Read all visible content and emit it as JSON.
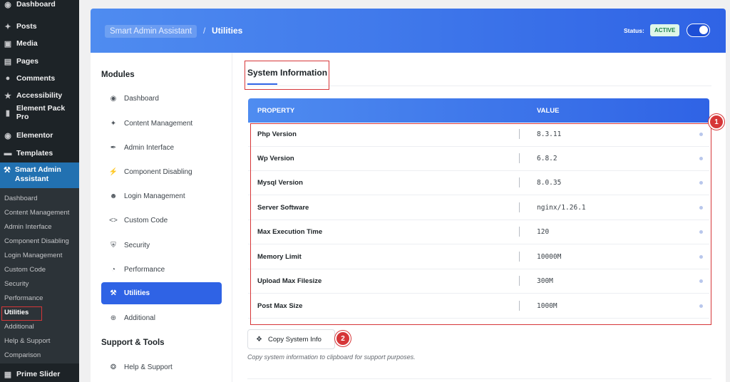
{
  "wp_menu": [
    {
      "label": "Dashboard",
      "icon": "dashboard-icon"
    },
    {
      "label": "Posts",
      "icon": "pin-icon"
    },
    {
      "label": "Media",
      "icon": "media-icon"
    },
    {
      "label": "Pages",
      "icon": "pages-icon"
    },
    {
      "label": "Comments",
      "icon": "comment-icon"
    },
    {
      "label": "Accessibility",
      "icon": "star-icon"
    },
    {
      "label": "Element Pack Pro",
      "icon": "element-pack-icon"
    },
    {
      "label": "Elementor",
      "icon": "elementor-icon"
    },
    {
      "label": "Templates",
      "icon": "folder-icon"
    },
    {
      "label": "Smart Admin Assistant",
      "icon": "wrench-icon"
    },
    {
      "label": "Prime Slider",
      "icon": "prime-slider-icon"
    }
  ],
  "wp_submenu": [
    "Dashboard",
    "Content Management",
    "Admin Interface",
    "Component Disabling",
    "Login Management",
    "Custom Code",
    "Security",
    "Performance",
    "Utilities",
    "Additional",
    "Help & Support",
    "Comparison"
  ],
  "header": {
    "plugin_name": "Smart Admin Assistant",
    "separator": "/",
    "current_page": "Utilities",
    "status_label": "Status:",
    "status_value": "ACTIVE",
    "status_color": "#1a7f4b",
    "toggle_on": true
  },
  "modules": {
    "heading": "Modules",
    "items": [
      {
        "label": "Dashboard",
        "icon": "palette-icon"
      },
      {
        "label": "Content Management",
        "icon": "pin-icon"
      },
      {
        "label": "Admin Interface",
        "icon": "brush-icon"
      },
      {
        "label": "Component Disabling",
        "icon": "plug-icon"
      },
      {
        "label": "Login Management",
        "icon": "user-icon"
      },
      {
        "label": "Custom Code",
        "icon": "code-icon"
      },
      {
        "label": "Security",
        "icon": "shield-icon"
      },
      {
        "label": "Performance",
        "icon": "gauge-icon"
      },
      {
        "label": "Utilities",
        "icon": "wrench-icon"
      },
      {
        "label": "Additional",
        "icon": "plus-circle-icon"
      }
    ],
    "support_heading": "Support & Tools",
    "support_items": [
      {
        "label": "Help & Support",
        "icon": "lifebuoy-icon"
      }
    ]
  },
  "content": {
    "section_title": "System Information",
    "table": {
      "col_property": "PROPERTY",
      "col_value": "VALUE",
      "rows": [
        {
          "property": "Php Version",
          "value": "8.3.11"
        },
        {
          "property": "Wp Version",
          "value": "6.8.2"
        },
        {
          "property": "Mysql Version",
          "value": "8.0.35"
        },
        {
          "property": "Server Software",
          "value": "nginx/1.26.1"
        },
        {
          "property": "Max Execution Time",
          "value": "120"
        },
        {
          "property": "Memory Limit",
          "value": "10000M"
        },
        {
          "property": "Upload Max Filesize",
          "value": "300M"
        },
        {
          "property": "Post Max Size",
          "value": "1000M"
        }
      ]
    },
    "copy_button": "Copy System Info",
    "copy_help": "Copy system information to clipboard for support purposes."
  },
  "annotations": [
    "1",
    "2"
  ],
  "colors": {
    "accent": "#2f63e5",
    "highlight": "#d63638",
    "wp_sidebar": "#1d2327",
    "wp_current": "#2271b1"
  }
}
